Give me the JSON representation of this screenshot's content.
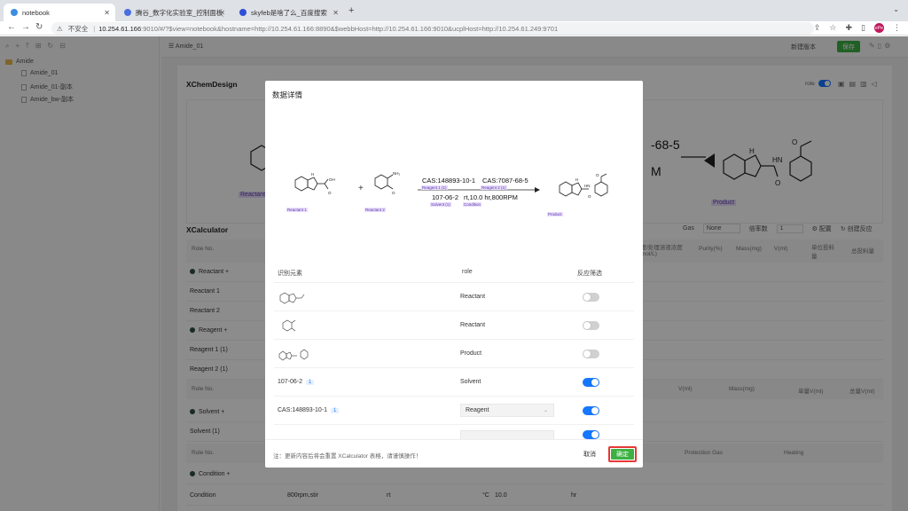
{
  "browser": {
    "tabs": [
      {
        "title": "notebook",
        "active": true
      },
      {
        "title": "腾谷_数字化实验室_控制面板_F",
        "active": false
      },
      {
        "title": "skyfeb是啥了么_百度搜索",
        "active": false
      }
    ],
    "new_tab": "+",
    "address": {
      "warning": "不安全",
      "host": "10.254.61.166",
      "path": ":9010/#/?$view=notebook&hostname=http://10.254.61.166:8890&$webbHost=http://10.254.61.166:9010&ucplHost=http://10.254.61.249:9701"
    },
    "profile": "ePe"
  },
  "sidebar": {
    "tree": [
      {
        "label": "Amide",
        "type": "folder"
      },
      {
        "label": "Amide_01",
        "type": "file"
      },
      {
        "label": "Amide_01-副本",
        "type": "file"
      },
      {
        "label": "Amide_bw-副本",
        "type": "file"
      }
    ]
  },
  "main": {
    "notebook_title": "Amide_01",
    "new_version": "新建版本",
    "save": "保存",
    "xchem_title": "XChemDesign",
    "role_label": "role",
    "bg_labels": {
      "reactant": "Reactant 1",
      "product": "Product",
      "cas_fragment": "-68-5",
      "m": "M"
    },
    "xcalc_title": "XCalculator",
    "gas_label": "Gas",
    "gas_value": "None",
    "multiplier_label": "倍率数",
    "multiplier_value": "1",
    "config": "配置",
    "create_reaction": "创建反应",
    "header1": {
      "role_no": "Role No.",
      "conc": "浓度/处理溶液浓度C(mol/L)",
      "purity": "Purity(%)",
      "mass": "Mass(mg)",
      "vml": "V(ml)",
      "unit": "单位投料量",
      "total": "总投料量"
    },
    "sections": {
      "reactant": "Reactant",
      "reactant1": "Reactant 1",
      "reactant2": "Reactant 2",
      "reagent": "Reagent",
      "reagent1": "Reagent 1 (1)",
      "reagent2": "Reagent 2 (1)",
      "solvent": "Solvent",
      "solvent1": "Solvent (1)",
      "condition": "Condition"
    },
    "header2": {
      "role_no": "Role No.",
      "vml": "V(ml)",
      "mass": "Mass(mg)",
      "unitv": "单量V(ml)",
      "totalv": "总量V(ml)"
    },
    "header3": {
      "role_no": "Role No.",
      "gas": "Protection Gas",
      "heating": "Heating"
    },
    "condition_row": {
      "label": "Condition",
      "stir": "800rpm,stir",
      "temp": "rt",
      "unit": "°C",
      "value": "10.0",
      "time_unit": "hr"
    }
  },
  "modal": {
    "title": "数据详情",
    "reaction": {
      "above_arrow_1": "CAS:148893-10-1",
      "above_arrow_2": "CAS:7087-68-5",
      "below_arrow_1": "107-06-2",
      "below_arrow_2": "rt,10.0 hr,800RPM",
      "labels": {
        "reactant1": "Reactant 1",
        "reactant2": "Reactant 2",
        "reagent1": "Reagent 1 (1)",
        "reagent2": "Reagent 2 (1)",
        "solvent1": "Solvent (1)",
        "condition": "Condition",
        "product": "Product"
      }
    },
    "table": {
      "headers": {
        "element": "识别元素",
        "role": "role",
        "filter": "反应筛选"
      },
      "rows": [
        {
          "element_kind": "structure",
          "icon": "structure-thumbnail",
          "role": "Reactant",
          "enabled": false
        },
        {
          "element_kind": "structure",
          "icon": "structure-thumbnail",
          "role": "Reactant",
          "enabled": false
        },
        {
          "element_kind": "structure",
          "icon": "structure-thumbnail",
          "role": "Product",
          "enabled": false
        },
        {
          "element_kind": "text",
          "element": "107-06-2",
          "badge": "1",
          "role": "Solvent",
          "enabled": true
        },
        {
          "element_kind": "text",
          "element": "CAS:148893-10-1",
          "badge": "1",
          "role": "Reagent",
          "role_select": true,
          "enabled": true
        }
      ]
    },
    "note": "注：更新内容后将会重置 XCalculator 表格，请谨慎操作！",
    "cancel": "取消",
    "confirm": "确定"
  },
  "colors": {
    "accent": "#1677ff",
    "save_green": "#3cb043",
    "highlight_red": "#e53935",
    "label_purple": "#eadcff"
  }
}
